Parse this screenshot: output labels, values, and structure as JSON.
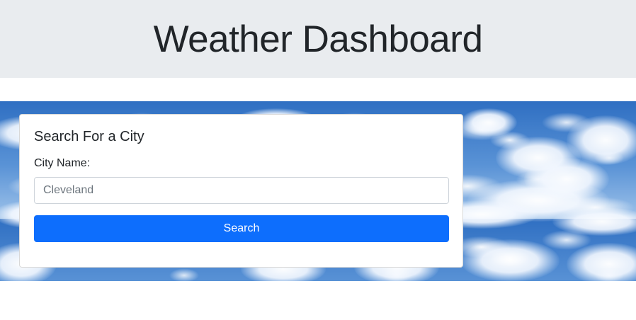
{
  "header": {
    "title": "Weather Dashboard"
  },
  "search_card": {
    "title": "Search For a City",
    "field_label": "City Name:",
    "input_placeholder": "Cleveland",
    "input_value": "",
    "button_label": "Search"
  },
  "colors": {
    "header_bg": "#e9ecef",
    "button_bg": "#0d6efd",
    "sky_blue": "#3f7fcb"
  }
}
